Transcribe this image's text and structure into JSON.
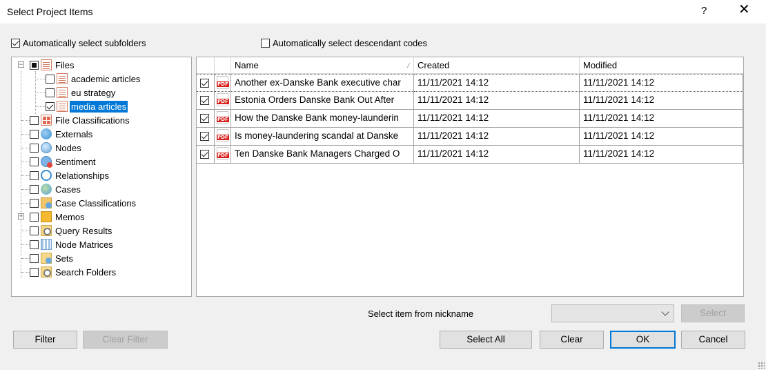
{
  "window": {
    "title": "Select Project Items",
    "help_label": "?",
    "close_glyph": "✕"
  },
  "options": {
    "auto_subfolders": {
      "label": "Automatically select subfolders",
      "checked": true
    },
    "auto_descendants": {
      "label": "Automatically select descendant codes",
      "checked": false
    }
  },
  "tree": {
    "items": [
      {
        "label": "Files",
        "icon": "document-stack-icon",
        "state": "partial"
      },
      {
        "label": "academic articles",
        "icon": "document-stack-icon",
        "state": "unchecked"
      },
      {
        "label": "eu strategy",
        "icon": "document-stack-icon",
        "state": "unchecked"
      },
      {
        "label": "media articles",
        "icon": "document-stack-icon",
        "state": "checked",
        "selected": true
      },
      {
        "label": "File Classifications",
        "icon": "file-classification-icon",
        "state": "unchecked"
      },
      {
        "label": "Externals",
        "icon": "external-icon",
        "state": "unchecked"
      },
      {
        "label": "Nodes",
        "icon": "node-icon",
        "state": "unchecked"
      },
      {
        "label": "Sentiment",
        "icon": "sentiment-icon",
        "state": "unchecked"
      },
      {
        "label": "Relationships",
        "icon": "relationship-icon",
        "state": "unchecked"
      },
      {
        "label": "Cases",
        "icon": "cases-icon",
        "state": "unchecked"
      },
      {
        "label": "Case Classifications",
        "icon": "case-classification-icon",
        "state": "unchecked"
      },
      {
        "label": "Memos",
        "icon": "memo-icon",
        "state": "unchecked"
      },
      {
        "label": "Query Results",
        "icon": "query-results-icon",
        "state": "unchecked"
      },
      {
        "label": "Node Matrices",
        "icon": "matrix-icon",
        "state": "unchecked"
      },
      {
        "label": "Sets",
        "icon": "sets-icon",
        "state": "unchecked"
      },
      {
        "label": "Search Folders",
        "icon": "search-folder-icon",
        "state": "unchecked"
      }
    ]
  },
  "grid": {
    "columns": {
      "name": "Name",
      "created": "Created",
      "modified": "Modified"
    },
    "rows": [
      {
        "name": "Another ex-Danske Bank executive char",
        "created": "11/11/2021 14:12",
        "modified": "11/11/2021 14:12",
        "checked": true,
        "icon": "PDF"
      },
      {
        "name": "Estonia Orders Danske Bank Out After",
        "created": "11/11/2021 14:12",
        "modified": "11/11/2021 14:12",
        "checked": true,
        "icon": "PDF"
      },
      {
        "name": "How the Danske Bank money-launderin",
        "created": "11/11/2021 14:12",
        "modified": "11/11/2021 14:12",
        "checked": true,
        "icon": "PDF"
      },
      {
        "name": "Is money-laundering scandal at Danske",
        "created": "11/11/2021 14:12",
        "modified": "11/11/2021 14:12",
        "checked": true,
        "icon": "PDF"
      },
      {
        "name": "Ten Danske Bank Managers Charged O",
        "created": "11/11/2021 14:12",
        "modified": "11/11/2021 14:12",
        "checked": true,
        "icon": "PDF"
      }
    ]
  },
  "nickname": {
    "label": "Select item from nickname",
    "value": "",
    "select_label": "Select"
  },
  "buttons": {
    "filter": "Filter",
    "clear_filter": "Clear Filter",
    "select_all": "Select All",
    "clear": "Clear",
    "ok": "OK",
    "cancel": "Cancel"
  }
}
